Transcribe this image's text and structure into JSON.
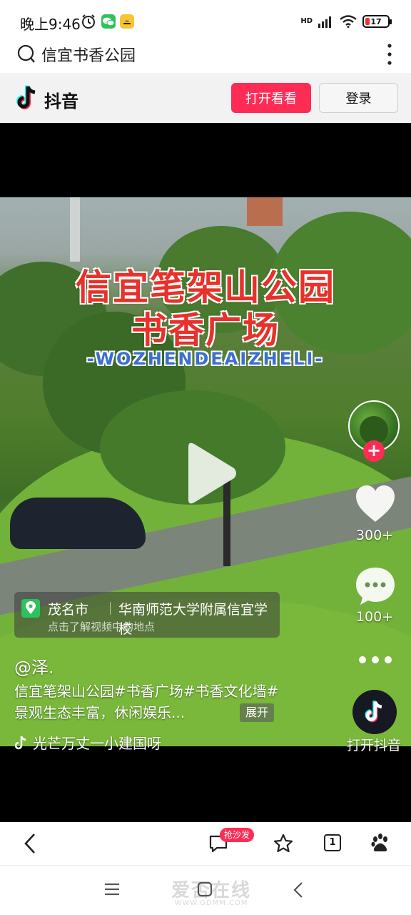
{
  "status_bar": {
    "time": "晚上9:46",
    "network": "HD",
    "battery": "17",
    "icons": [
      "alarm-icon",
      "wechat-icon",
      "app-notification-icon",
      "signal-icon",
      "wifi-icon",
      "battery-icon"
    ]
  },
  "search": {
    "query": "信宜书香公园"
  },
  "douyin_header": {
    "brand": "抖音",
    "open_button": "打开看看",
    "login_button": "登录",
    "accent": "#fe2c55"
  },
  "video": {
    "overlay_title_line1": "信宜笔架山公园",
    "overlay_title_line2": "书香广场",
    "overlay_subtitle": "-WOZHENDEAIZHELI-"
  },
  "location": {
    "city": "茂名市",
    "place": "华南师范大学附属信宜学校",
    "hint": "点击了解视频中的地点"
  },
  "post": {
    "author": "@泽.",
    "description": "信宜笔架山公园#书香广场#书香文化墙#景观生态丰富，休闲娱乐...",
    "expand": "展开",
    "music": "光芒万丈一小建国呀"
  },
  "rail": {
    "likes": "300+",
    "comments": "100+",
    "open_app": "打开抖音"
  },
  "bottom_bar": {
    "sofa_badge": "抢沙发",
    "tab_count": "1"
  },
  "watermark": {
    "text": "爱否在线",
    "url": "WWW.GDMM.COM"
  }
}
